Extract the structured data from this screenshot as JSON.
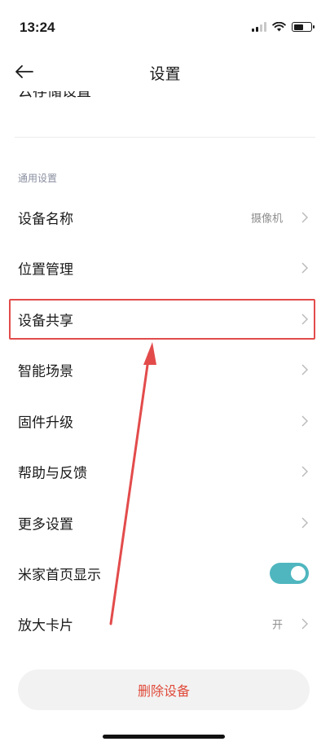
{
  "status_bar": {
    "time": "13:24"
  },
  "nav": {
    "title": "设置"
  },
  "cut_off_item": {
    "label": "云存储设置"
  },
  "section": {
    "header": "通用设置"
  },
  "items": [
    {
      "label": "设备名称",
      "value": "摄像机",
      "control": "chevron"
    },
    {
      "label": "位置管理",
      "value": "",
      "control": "chevron"
    },
    {
      "label": "设备共享",
      "value": "",
      "control": "chevron",
      "highlighted": true
    },
    {
      "label": "智能场景",
      "value": "",
      "control": "chevron"
    },
    {
      "label": "固件升级",
      "value": "",
      "control": "chevron"
    },
    {
      "label": "帮助与反馈",
      "value": "",
      "control": "chevron"
    },
    {
      "label": "更多设置",
      "value": "",
      "control": "chevron"
    },
    {
      "label": "米家首页显示",
      "value": "",
      "control": "toggle",
      "toggle_on": true
    },
    {
      "label": "放大卡片",
      "value": "开",
      "control": "chevron"
    }
  ],
  "delete_button": {
    "label": "删除设备"
  },
  "colors": {
    "accent_toggle": "#4fb6bf",
    "delete_text": "#e04a3a",
    "annotation_red": "#e34b4b"
  }
}
